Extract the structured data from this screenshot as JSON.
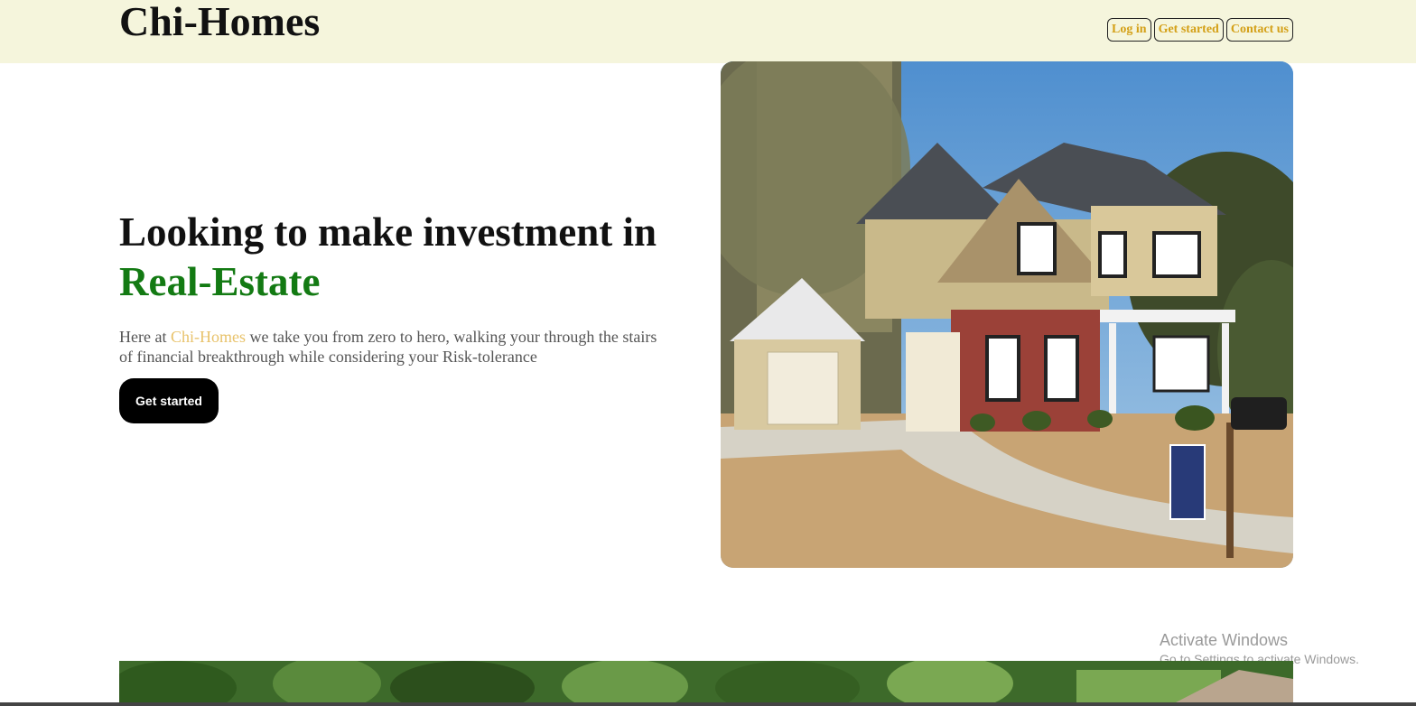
{
  "header": {
    "brand": "Chi-Homes",
    "nav": {
      "login": "Log in",
      "get_started": "Get started",
      "contact": "Contact us"
    }
  },
  "hero": {
    "headline_part1": "Looking to make investment in ",
    "headline_accent": "Real-Estate",
    "lead_prefix": "Here at ",
    "lead_brand": "Chi-Homes",
    "lead_suffix": " we take you from zero to hero, walking your through the stairs of financial breakthrough while considering your Risk-tolerance",
    "cta": "Get started"
  },
  "watermark": {
    "line1": "Activate Windows",
    "line2": "Go to Settings to activate Windows."
  },
  "colors": {
    "header_bg": "#f5f5dc",
    "accent_green": "#137a13",
    "brand_gold": "#e8c26a",
    "nav_text": "#d4a017",
    "cta_bg": "#000000"
  }
}
